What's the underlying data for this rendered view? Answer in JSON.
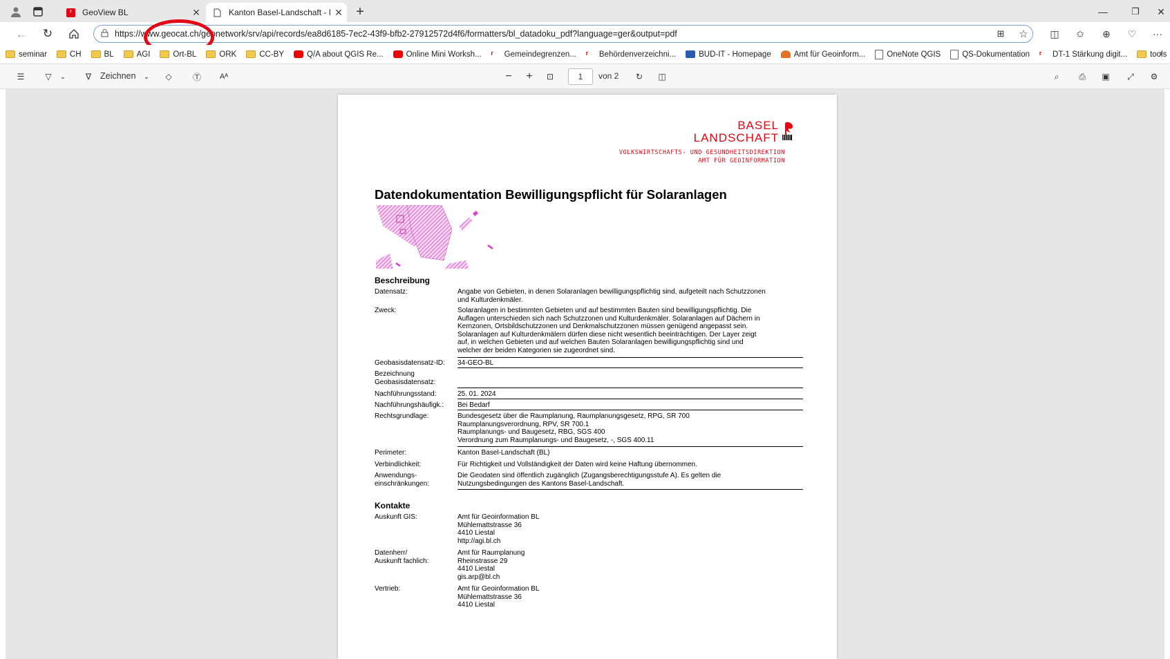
{
  "browser": {
    "tabs": [
      {
        "title": "GeoView BL",
        "active": false
      },
      {
        "title": "Kanton Basel-Landschaft - Metad",
        "active": true
      }
    ],
    "url": "https://www.geocat.ch/geonetwork/srv/api/records/ea8d6185-7ec2-43f9-bfb2-27912572d4f6/formatters/bl_datadoku_pdf?language=ger&output=pdf",
    "bookmarks": [
      {
        "label": "seminar",
        "icon": "folder-icon"
      },
      {
        "label": "CH",
        "icon": "folder-icon"
      },
      {
        "label": "BL",
        "icon": "folder-icon"
      },
      {
        "label": "AGI",
        "icon": "folder-icon"
      },
      {
        "label": "Ort-BL",
        "icon": "folder-icon"
      },
      {
        "label": "ORK",
        "icon": "folder-icon"
      },
      {
        "label": "CC-BY",
        "icon": "folder-icon"
      },
      {
        "label": "Q/A about QGIS Re...",
        "icon": "youtube-icon"
      },
      {
        "label": "Online Mini Worksh...",
        "icon": "youtube-icon"
      },
      {
        "label": "Gemeindegrenzen...",
        "icon": "bl-logo-icon"
      },
      {
        "label": "Behördenverzeichni...",
        "icon": "bl-logo-icon"
      },
      {
        "label": "BUD-IT - Homepage",
        "icon": "bud-icon"
      },
      {
        "label": "Amt für Geoinform...",
        "icon": "gitlab-icon"
      },
      {
        "label": "OneNote QGIS",
        "icon": "page-icon"
      },
      {
        "label": "QS-Dokumentation",
        "icon": "page-icon"
      },
      {
        "label": "DT-1 Stärkung digit...",
        "icon": "bl-logo-icon"
      },
      {
        "label": "tools",
        "icon": "folder-icon"
      }
    ]
  },
  "pdf_toolbar": {
    "draw_label": "Zeichnen",
    "page_current": "1",
    "page_total": "von 2"
  },
  "document": {
    "logo_line1": "BASEL",
    "logo_line2": "LANDSCHAFT",
    "dept_line1": "VOLKSWIRTSCHAFTS- UND GESUNDHEITSDIREKTION",
    "dept_line2": "AMT FÜR GEOINFORMATION",
    "title": "Datendokumentation Bewilligungspflicht für Solaranlagen",
    "section_beschreibung": "Beschreibung",
    "rows": [
      {
        "label": "Datensatz:",
        "value": "Angabe von Gebieten, in denen Solaranlagen bewilligungspflichtig sind, aufgeteilt nach Schutzzonen\nund Kulturdenkmäler."
      },
      {
        "label": "Zweck:",
        "value": "Solaranlagen in bestimmten Gebieten und auf bestimmten Bauten sind bewilligungspflichtig. Die\nAuflagen unterschieden sich nach Schutzzonen und Kulturdenkmäler. Solaranlagen auf Dächern in\nKernzonen, Ortsbildschutzzonen und Denkmalschutzzonen müssen genügend angepasst sein.\nSolaranlagen auf Kulturdenkmälern dürfen diese nicht wesentlich beeinträchtigen. Der Layer zeigt\nauf, in welchen Gebieten und auf welchen Bauten Solaranlagen bewilligungspflichtig sind und\nwelcher der beiden Kategorien sie zugeordnet sind."
      },
      {
        "label": "Geobasisdatensatz-ID:",
        "value": "34-GEO-BL"
      },
      {
        "label": "Bezeichnung\nGeobasisdatensatz:",
        "value": ""
      },
      {
        "label": "Nachführungsstand:",
        "value": "25. 01. 2024"
      },
      {
        "label": "Nachführungshäufigk.:",
        "value": "Bei Bedarf"
      },
      {
        "label": "Rechtsgrundlage:",
        "value": "Bundesgesetz über die Raumplanung, Raumplanungsgesetz, RPG, SR 700\nRaumplanungsverordnung, RPV, SR 700.1\nRaumplanungs- und Baugesetz, RBG, SGS 400\nVerordnung zum Raumplanungs- und Baugesetz, -, SGS 400.11"
      },
      {
        "label": "Perimeter:",
        "value": "Kanton Basel-Landschaft (BL)"
      },
      {
        "label": "Verbindlichkeit:",
        "value": "Für Richtigkeit und Vollständigkeit der Daten wird keine Haftung übernommen."
      },
      {
        "label": "Anwendungs-\neinschränkungen:",
        "value": "Die Geodaten sind öffentlich zugänglich (Zugangsberechtigungsstufe A). Es gelten die\nNutzungsbedingungen des Kantons Basel-Landschaft."
      }
    ],
    "section_kontakte": "Kontakte",
    "contacts": [
      {
        "label": "Auskunft GIS:",
        "value": "Amt für Geoinformation BL\nMühlemattstrasse  36\n4410  Liestal\nhttp://agi.bl.ch"
      },
      {
        "label": "Datenherr/\nAuskunft fachlich:",
        "value": "Amt für Raumplanung\nRheinstrasse  29\n4410  Liestal\ngis.arp@bl.ch"
      },
      {
        "label": "Vertrieb:",
        "value": "Amt für Geoinformation BL\nMühlemattstrasse  36\n4410  Liestal"
      }
    ]
  },
  "colors": {
    "accent_red": "#e30613",
    "hatch_pink": "#d946c6"
  }
}
